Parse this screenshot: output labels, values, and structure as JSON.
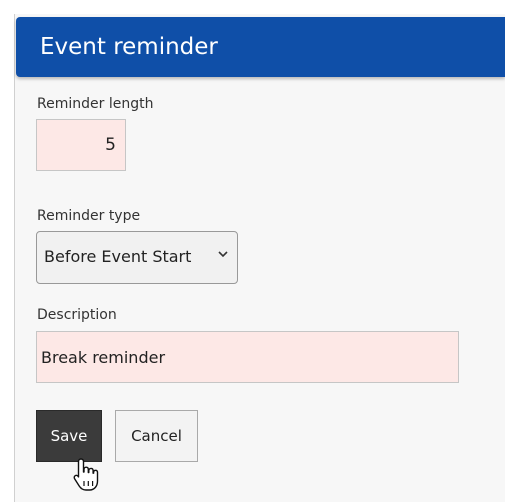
{
  "dialog": {
    "title": "Event reminder",
    "header_color": "#0f4fa8"
  },
  "form": {
    "reminder_length": {
      "label": "Reminder length",
      "value": "5"
    },
    "reminder_type": {
      "label": "Reminder type",
      "selected": "Before Event Start"
    },
    "description": {
      "label": "Description",
      "value": "Break reminder"
    }
  },
  "actions": {
    "save_label": "Save",
    "cancel_label": "Cancel"
  },
  "icons": {
    "select_arrow": "chevron-down-icon",
    "pointer": "hand-pointer-icon"
  },
  "colors": {
    "field_invalid_bg": "#fde8e6",
    "primary_button_bg": "#3b3b3b"
  }
}
